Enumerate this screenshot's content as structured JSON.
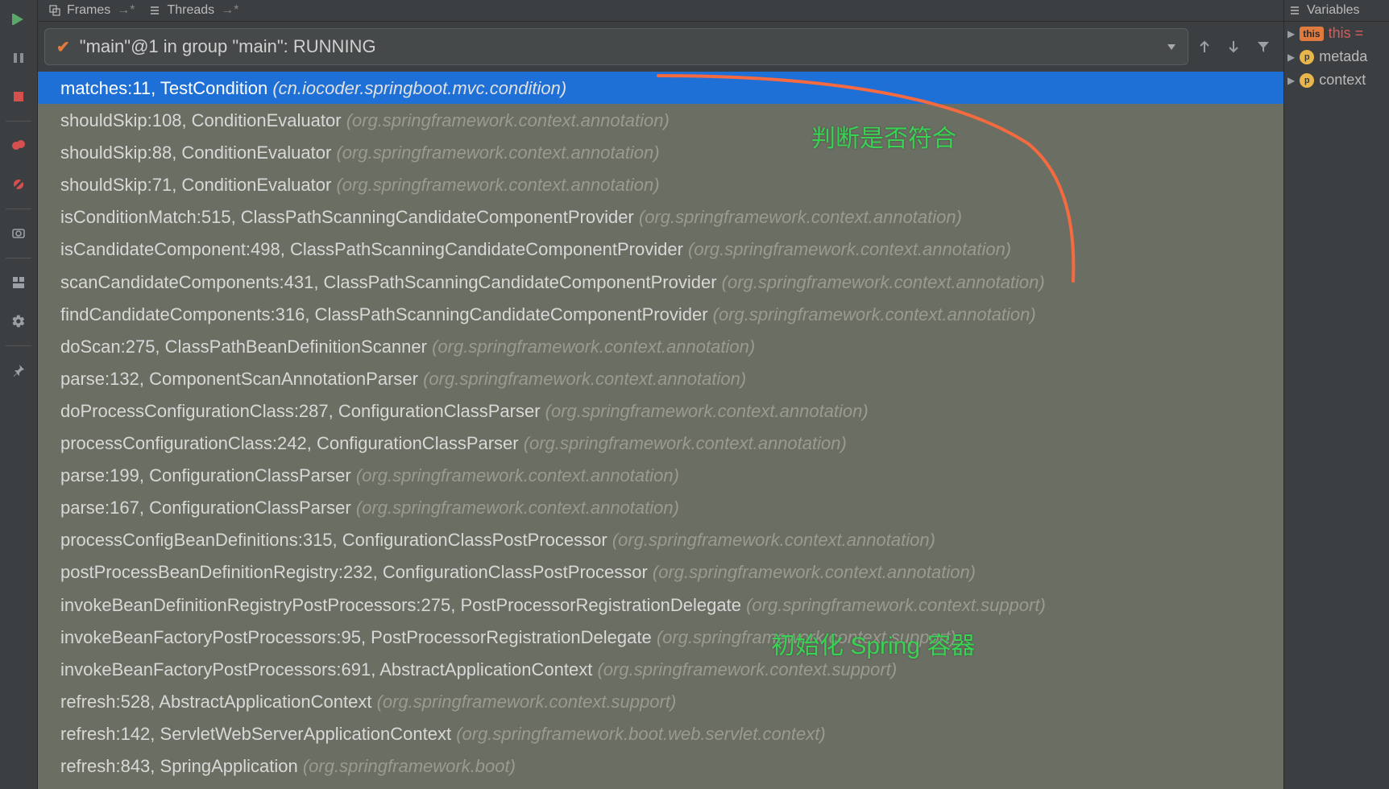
{
  "tabs": {
    "frames_label": "Frames",
    "threads_label": "Threads"
  },
  "thread_selector": "\"main\"@1 in group \"main\": RUNNING",
  "frames": [
    {
      "main": "matches:11, TestCondition ",
      "pkg": "(cn.iocoder.springboot.mvc.condition)",
      "selected": true
    },
    {
      "main": "shouldSkip:108, ConditionEvaluator ",
      "pkg": "(org.springframework.context.annotation)"
    },
    {
      "main": "shouldSkip:88, ConditionEvaluator ",
      "pkg": "(org.springframework.context.annotation)"
    },
    {
      "main": "shouldSkip:71, ConditionEvaluator ",
      "pkg": "(org.springframework.context.annotation)"
    },
    {
      "main": "isConditionMatch:515, ClassPathScanningCandidateComponentProvider ",
      "pkg": "(org.springframework.context.annotation)"
    },
    {
      "main": "isCandidateComponent:498, ClassPathScanningCandidateComponentProvider ",
      "pkg": "(org.springframework.context.annotation)"
    },
    {
      "main": "scanCandidateComponents:431, ClassPathScanningCandidateComponentProvider ",
      "pkg": "(org.springframework.context.annotation)"
    },
    {
      "main": "findCandidateComponents:316, ClassPathScanningCandidateComponentProvider ",
      "pkg": "(org.springframework.context.annotation)"
    },
    {
      "main": "doScan:275, ClassPathBeanDefinitionScanner ",
      "pkg": "(org.springframework.context.annotation)"
    },
    {
      "main": "parse:132, ComponentScanAnnotationParser ",
      "pkg": "(org.springframework.context.annotation)"
    },
    {
      "main": "doProcessConfigurationClass:287, ConfigurationClassParser ",
      "pkg": "(org.springframework.context.annotation)"
    },
    {
      "main": "processConfigurationClass:242, ConfigurationClassParser ",
      "pkg": "(org.springframework.context.annotation)"
    },
    {
      "main": "parse:199, ConfigurationClassParser ",
      "pkg": "(org.springframework.context.annotation)"
    },
    {
      "main": "parse:167, ConfigurationClassParser ",
      "pkg": "(org.springframework.context.annotation)"
    },
    {
      "main": "processConfigBeanDefinitions:315, ConfigurationClassPostProcessor ",
      "pkg": "(org.springframework.context.annotation)"
    },
    {
      "main": "postProcessBeanDefinitionRegistry:232, ConfigurationClassPostProcessor ",
      "pkg": "(org.springframework.context.annotation)"
    },
    {
      "main": "invokeBeanDefinitionRegistryPostProcessors:275, PostProcessorRegistrationDelegate ",
      "pkg": "(org.springframework.context.support)"
    },
    {
      "main": "invokeBeanFactoryPostProcessors:95, PostProcessorRegistrationDelegate ",
      "pkg": "(org.springframework.context.support)"
    },
    {
      "main": "invokeBeanFactoryPostProcessors:691, AbstractApplicationContext ",
      "pkg": "(org.springframework.context.support)"
    },
    {
      "main": "refresh:528, AbstractApplicationContext ",
      "pkg": "(org.springframework.context.support)"
    },
    {
      "main": "refresh:142, ServletWebServerApplicationContext ",
      "pkg": "(org.springframework.boot.web.servlet.context)"
    },
    {
      "main": "refresh:843, SpringApplication ",
      "pkg": "(org.springframework.boot)"
    }
  ],
  "annotations": {
    "top": "判断是否符合",
    "bottom": "初始化 Spring 容器"
  },
  "variables_panel": {
    "title": "Variables",
    "rows": [
      {
        "kind": "this",
        "name": "this",
        "extra": " = "
      },
      {
        "kind": "p",
        "name": "metada"
      },
      {
        "kind": "p",
        "name": "context"
      }
    ]
  }
}
